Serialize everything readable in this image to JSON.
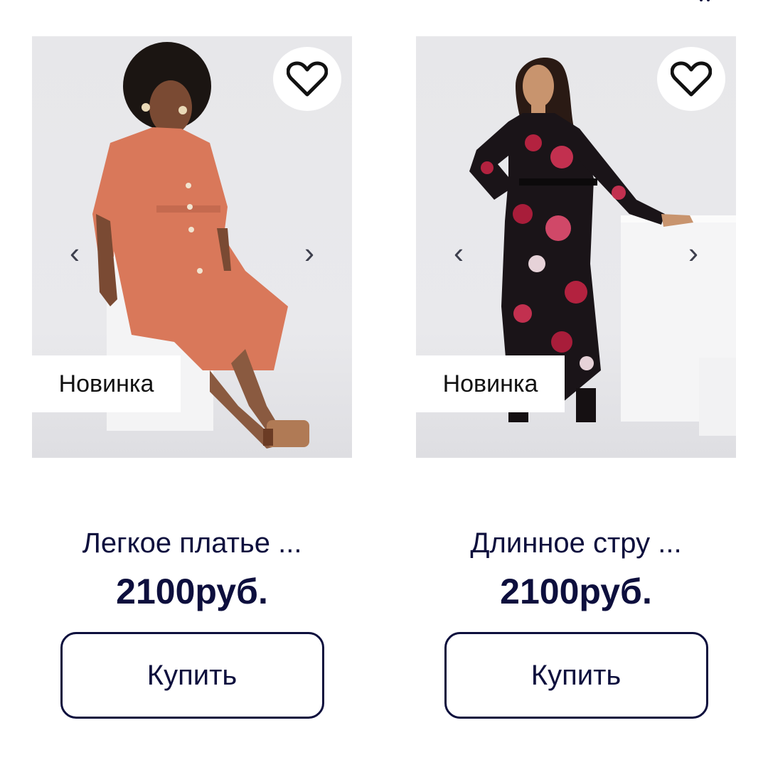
{
  "products": [
    {
      "badge": "Новинка",
      "title": "Легкое платье ...",
      "price": "2100руб.",
      "buy_label": "Купить",
      "prev_arrow": "‹",
      "next_arrow": "›",
      "dress_color": "#d9785a"
    },
    {
      "badge": "Новинка",
      "title": "Длинное стру ...",
      "price": "2100руб.",
      "buy_label": "Купить",
      "prev_arrow": "‹",
      "next_arrow": "›",
      "dress_color": "#1a1418"
    }
  ],
  "icons": {
    "favorite": "heart-outline-icon",
    "prev": "chevron-left-icon",
    "next": "chevron-right-icon"
  }
}
